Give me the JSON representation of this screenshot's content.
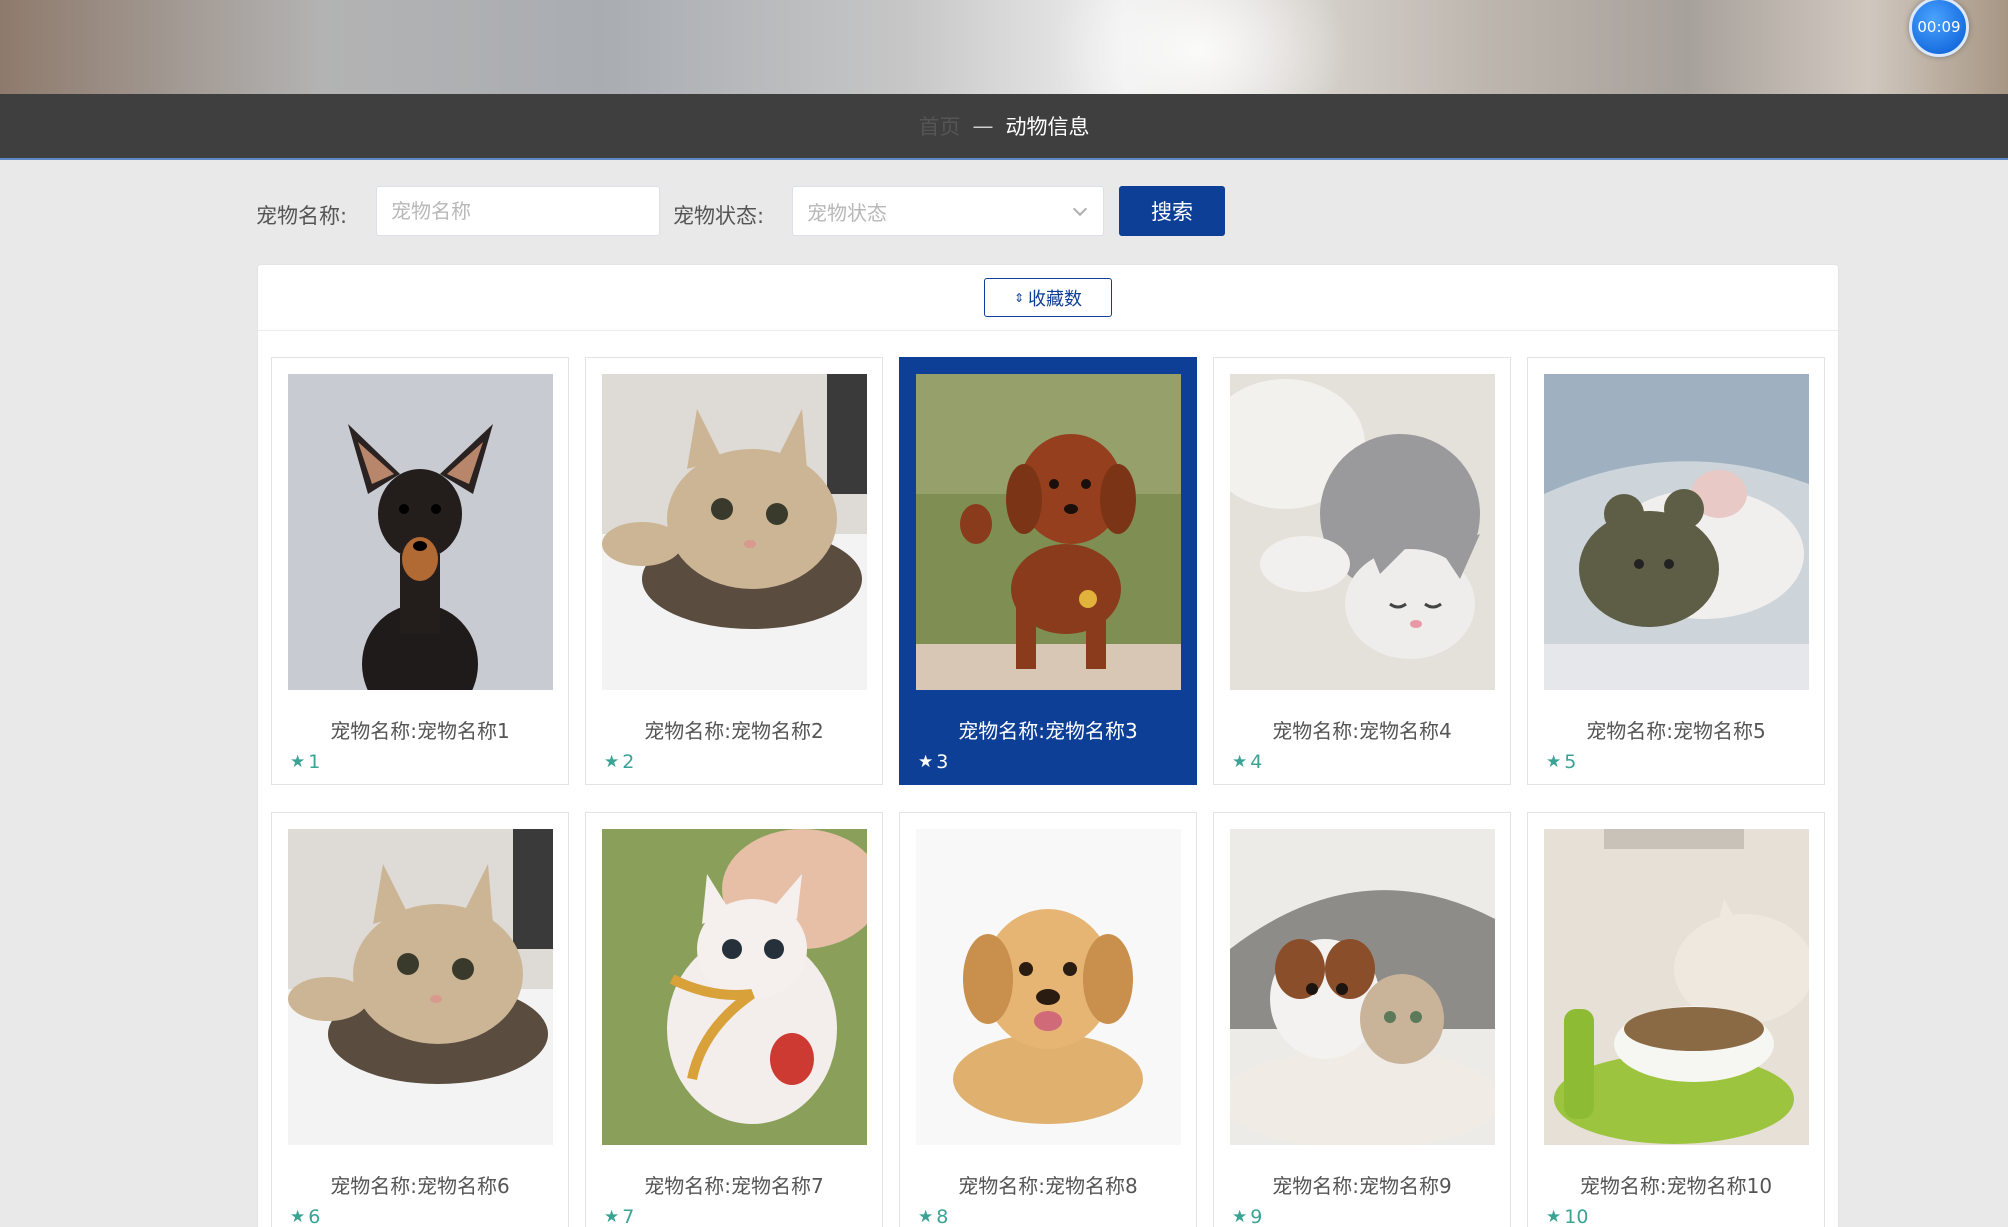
{
  "timer": "00:09",
  "breadcrumb": {
    "home": "首页",
    "separator": "—",
    "current": "动物信息"
  },
  "search": {
    "name_label": "宠物名称:",
    "name_placeholder": "宠物名称",
    "name_value": "",
    "status_label": "宠物状态:",
    "status_placeholder": "宠物状态",
    "button": "搜索"
  },
  "sort_button": "收藏数",
  "colors": {
    "primary": "#0e3f96",
    "star": "#3aa394",
    "breadcrumb_bg": "#3f3f3f"
  },
  "cards": [
    {
      "title": "宠物名称:宠物名称1",
      "favorites": "1",
      "active": false,
      "photo": "doberman-puppy-icon"
    },
    {
      "title": "宠物名称:宠物名称2",
      "favorites": "2",
      "active": false,
      "photo": "cat-in-bowl-icon"
    },
    {
      "title": "宠物名称:宠物名称3",
      "favorites": "3",
      "active": true,
      "photo": "poodle-icon"
    },
    {
      "title": "宠物名称:宠物名称4",
      "favorites": "4",
      "active": false,
      "photo": "sleeping-cat-icon"
    },
    {
      "title": "宠物名称:宠物名称5",
      "favorites": "5",
      "active": false,
      "photo": "hamster-with-teddy-icon"
    },
    {
      "title": "宠物名称:宠物名称6",
      "favorites": "6",
      "active": false,
      "photo": "cat-in-bowl-icon"
    },
    {
      "title": "宠物名称:宠物名称7",
      "favorites": "7",
      "active": false,
      "photo": "white-kitten-icon"
    },
    {
      "title": "宠物名称:宠物名称8",
      "favorites": "8",
      "active": false,
      "photo": "golden-puppy-icon"
    },
    {
      "title": "宠物名称:宠物名称9",
      "favorites": "9",
      "active": false,
      "photo": "dog-and-cat-icon"
    },
    {
      "title": "宠物名称:宠物名称10",
      "favorites": "10",
      "active": false,
      "photo": "cat-eating-icon"
    }
  ]
}
